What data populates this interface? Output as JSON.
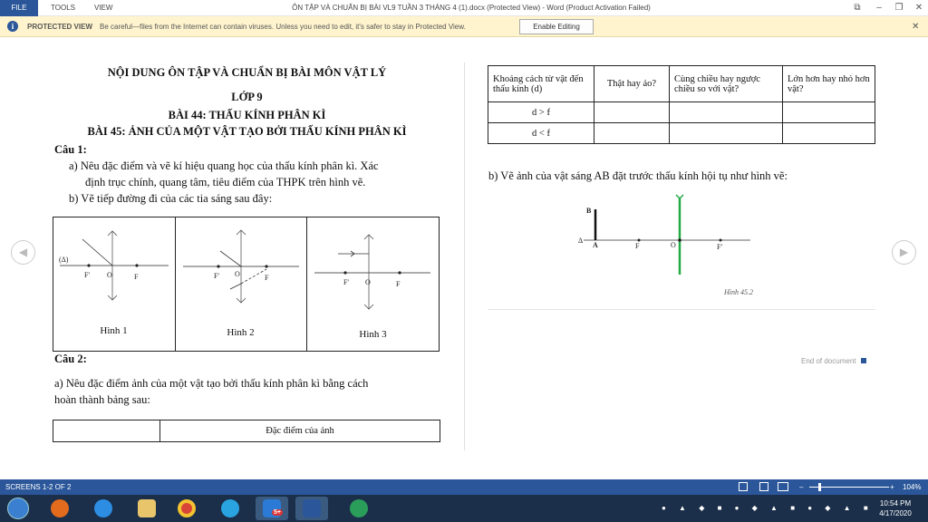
{
  "titlebar": {
    "file_tab": "FILE",
    "menu": [
      "TOOLS",
      "VIEW"
    ],
    "title": "ÔN TẬP VÀ CHUẨN BỊ BÀI VL9 TUẦN 3 THÁNG 4 (1).docx (Protected View) - Word (Product Activation Failed)"
  },
  "protected_view": {
    "label": "PROTECTED VIEW",
    "message": "Be careful—files from the Internet can contain viruses. Unless you need to edit, it's safer to stay in Protected View.",
    "enable_button": "Enable Editing"
  },
  "left_page": {
    "heading1": "NỘI DUNG ÔN TẬP VÀ CHUẨN BỊ BÀI MÔN VẬT LÝ",
    "heading2": "LỚP 9",
    "heading3": "BÀI 44: THẤU KÍNH PHÂN KÌ",
    "heading4": "BÀI 45: ẢNH CỦA MỘT VẬT TẠO BỞI THẤU KÍNH PHÂN KÌ",
    "q1_title": "Câu 1:",
    "q1_a_line1": "a) Nêu đặc điểm và vẽ kí hiệu quang học của thấu kính phân kì. Xác",
    "q1_a_line2": "định trục chính, quang tâm, tiêu điểm của THPK trên hình vẽ.",
    "q1_b": "b) Vẽ tiếp đường đi của các tia sáng sau đây:",
    "figures": [
      {
        "caption": "Hình 1",
        "axis_label": "(Δ)",
        "f_prime": "F'",
        "o": "O",
        "f": "F"
      },
      {
        "caption": "Hình 2",
        "f_prime": "F'",
        "o": "O",
        "f": "F"
      },
      {
        "caption": "Hình 3",
        "f_prime": "F'",
        "o": "O",
        "f": "F"
      }
    ],
    "q2_title": "Câu 2:",
    "q2_a_line1": "a) Nêu đặc điểm ảnh của một vật tạo bởi thấu kính phân kì bằng cách",
    "q2_a_line2": "hoàn thành bảng sau:",
    "table_header": "Đặc điểm của ảnh"
  },
  "right_page": {
    "table": {
      "headers": [
        "Khoảng cách từ vật đến thấu kính (d)",
        "Thật hay ảo?",
        "Cùng chiều hay ngược chiều so với vật?",
        "Lớn hơn hay nhỏ hơn vật?"
      ],
      "rows": [
        [
          "d > f",
          "",
          "",
          ""
        ],
        [
          "d < f",
          "",
          "",
          ""
        ]
      ]
    },
    "part_b": "b) Vẽ ảnh của vật sáng AB đặt trước thấu kính hội tụ như hình vẽ:",
    "diagram": {
      "b": "B",
      "a": "A",
      "delta": "Δ",
      "f": "F",
      "o": "O",
      "f_prime": "F'",
      "caption": "Hình 45.2",
      "lens_color": "#22aa44"
    },
    "end_of_document": "End of document"
  },
  "statusbar": {
    "screens": "SCREENS 1-2 OF 2",
    "zoom": "104%"
  },
  "taskbar": {
    "time": "10:54 PM",
    "date": "4/17/2020",
    "zalo_badge": "5+"
  },
  "colors": {
    "word_blue": "#2b579a",
    "taskbar": "#1b2f4a",
    "warning_bar": "#fff4ce"
  }
}
